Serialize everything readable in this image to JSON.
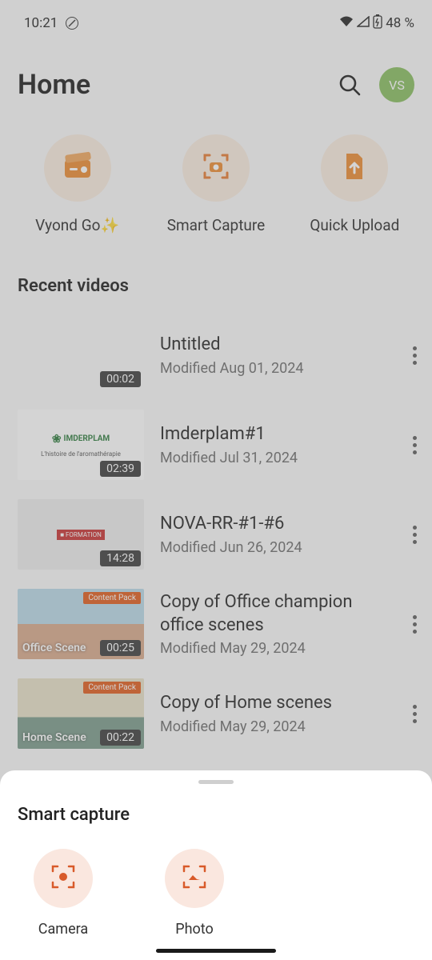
{
  "status": {
    "time": "10:21",
    "battery": "48 %"
  },
  "header": {
    "title": "Home",
    "avatar_initials": "VS"
  },
  "actions": [
    {
      "label": "Vyond Go✨",
      "icon": "clapperboard-icon"
    },
    {
      "label": "Smart Capture",
      "icon": "capture-icon"
    },
    {
      "label": "Quick Upload",
      "icon": "upload-icon"
    }
  ],
  "section_title": "Recent videos",
  "videos": [
    {
      "title": "Untitled",
      "modified": "Modified Aug 01, 2024",
      "duration": "00:02",
      "content_pack": null,
      "scene": null
    },
    {
      "title": "Imderplam#1",
      "modified": "Modified Jul 31, 2024",
      "duration": "02:39",
      "content_pack": null,
      "scene": null
    },
    {
      "title": "NOVA-RR-#1-#6",
      "modified": "Modified Jun 26, 2024",
      "duration": "14:28",
      "content_pack": null,
      "scene": null
    },
    {
      "title": "Copy of Office champion office scenes",
      "modified": "Modified May 29, 2024",
      "duration": "00:25",
      "content_pack": "Content Pack",
      "scene": "Office Scene"
    },
    {
      "title": "Copy of Home scenes",
      "modified": "Modified May 29, 2024",
      "duration": "00:22",
      "content_pack": "Content Pack",
      "scene": "Home Scene"
    }
  ],
  "sheet": {
    "title": "Smart capture",
    "actions": [
      {
        "label": "Camera",
        "icon": "camera-target-icon"
      },
      {
        "label": "Photo",
        "icon": "photo-target-icon"
      }
    ]
  },
  "thumb_text": {
    "imderplam_brand": "IMDERPLAM",
    "imderplam_tag": "L'histoire de l'aromathérapie"
  },
  "colors": {
    "accent": "#e67a2e",
    "avatar": "#87bd5e",
    "sheet_circle": "#fae7df"
  }
}
